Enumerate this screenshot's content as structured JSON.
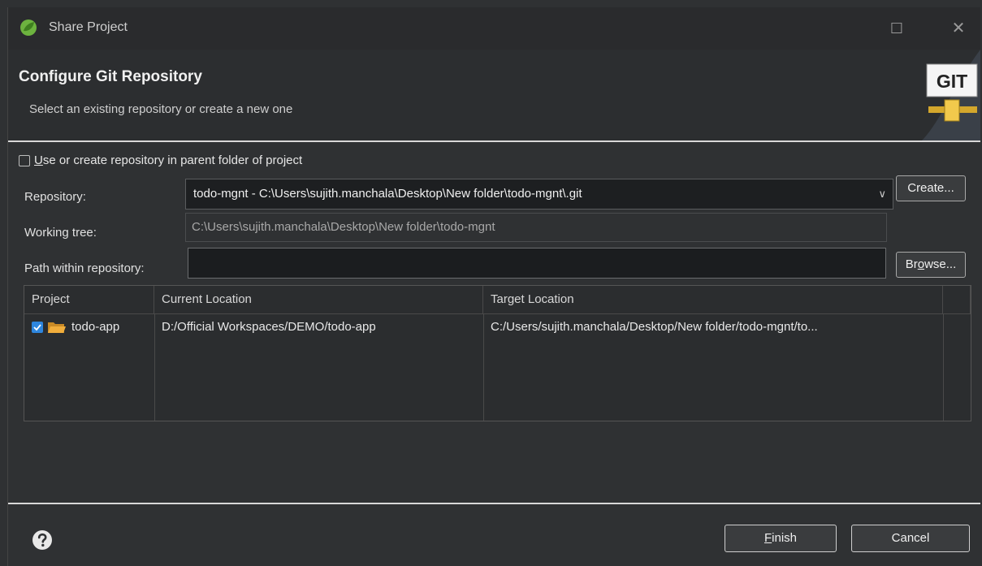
{
  "window": {
    "title": "Share Project",
    "maximize_glyph": "☐",
    "close_glyph": "✕"
  },
  "header": {
    "title": "Configure Git Repository",
    "subtitle": "Select an existing repository or create a new one",
    "logo_text": "GIT"
  },
  "form": {
    "parent_folder_checkbox": {
      "label_mnemonic": "U",
      "label_rest": "se or create repository in parent folder of project",
      "checked": false
    },
    "repository_label": "Repository:",
    "repository_value": "todo-mgnt - C:\\Users\\sujith.manchala\\Desktop\\New folder\\todo-mgnt\\.git",
    "combo_arrow": "∨",
    "create_button": "Create...",
    "working_tree_label": "Working tree:",
    "working_tree_value": "C:\\Users\\sujith.manchala\\Desktop\\New folder\\todo-mgnt",
    "path_label": "Path within repository:",
    "path_value": "",
    "browse_prefix": "Br",
    "browse_mnemonic": "o",
    "browse_suffix": "wse..."
  },
  "table": {
    "headers": [
      "Project",
      "Current Location",
      "Target Location"
    ],
    "rows": [
      {
        "project": "todo-app",
        "current_location": "D:/Official Workspaces/DEMO/todo-app",
        "target_location": "C:/Users/sujith.manchala/Desktop/New folder/todo-mgnt/to...",
        "checked": true
      }
    ]
  },
  "footer": {
    "finish_mnemonic": "F",
    "finish_rest": "inish",
    "cancel_button": "Cancel"
  },
  "colors": {
    "background": "#2f3133",
    "accent": "#2e86de",
    "folder": "#e8a33a"
  },
  "icons": [
    "spring-leaf-icon",
    "git-logo-icon",
    "folder-icon",
    "help-icon",
    "check-icon"
  ]
}
